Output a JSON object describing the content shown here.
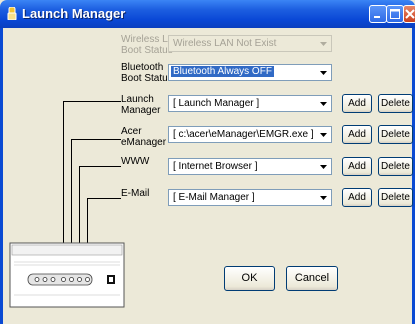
{
  "window": {
    "title": "Launch Manager"
  },
  "rows": {
    "wireless": {
      "label_line1": "Wireless LAN",
      "label_line2": "Boot Status",
      "value": "Wireless LAN Not Exist"
    },
    "bluetooth": {
      "label_line1": "Bluetooth",
      "label_line2": "Boot Status",
      "value": "Bluetooth Always OFF"
    },
    "launch_manager": {
      "label_line1": "Launch",
      "label_line2": "Manager",
      "value": "[ Launch Manager ]",
      "add": "Add",
      "delete": "Delete"
    },
    "emanager": {
      "label_line1": "Acer",
      "label_line2": "eManager",
      "value": "[ c:\\acer\\eManager\\EMGR.exe ]",
      "add": "Add",
      "delete": "Delete"
    },
    "www": {
      "label_line1": "WWW",
      "value": "[ Internet Browser ]",
      "add": "Add",
      "delete": "Delete"
    },
    "email": {
      "label_line1": "E-Mail",
      "value": "[ E-Mail Manager ]",
      "add": "Add",
      "delete": "Delete"
    }
  },
  "footer": {
    "ok": "OK",
    "cancel": "Cancel"
  },
  "colors": {
    "titlebar": "#0a48d6",
    "selection": "#316ac5",
    "dialog_bg": "#ece9d8"
  }
}
